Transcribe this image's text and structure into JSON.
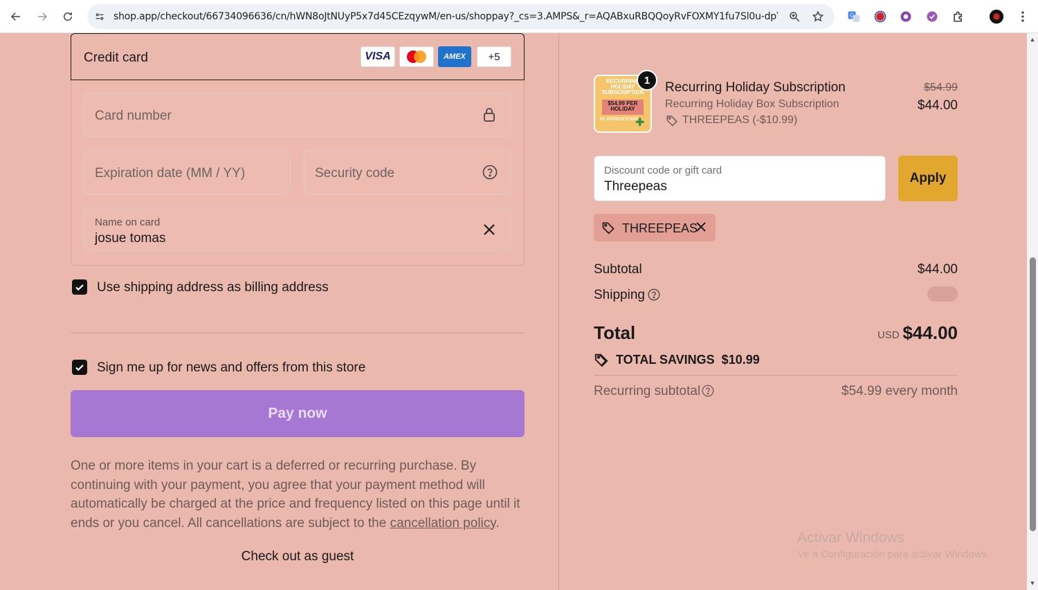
{
  "browser": {
    "url": "shop.app/checkout/66734096636/cn/hWN8oJtNUyP5x7d45CEzqywM/en-us/shoppay?_cs=3.AMPS&_r=AQABxuRBQQoyRvFOXMY1fu7Sl0u-dpYto-..."
  },
  "payment": {
    "credit_card_label": "Credit card",
    "brands": {
      "visa": "VISA",
      "amex": "AMEX",
      "more": "+5"
    },
    "card_number_placeholder": "Card number",
    "expiration_placeholder": "Expiration date (MM / YY)",
    "security_placeholder": "Security code",
    "name_label": "Name on card",
    "name_value": "josue tomas"
  },
  "options": {
    "billing_label": "Use shipping address as billing address",
    "newsletter_label": "Sign me up for news and offers from this store"
  },
  "pay_button": "Pay now",
  "disclaimer": {
    "text": "One or more items in your cart is a deferred or recurring purchase. By continuing with your payment, you agree that your payment method will automatically be charged at the price and frequency listed on this page until it ends or you cancel. All cancellations are subject to the ",
    "link": "cancellation policy",
    "end": "."
  },
  "guest_link": "Check out as guest",
  "summary": {
    "product": {
      "quantity": "1",
      "title": "Recurring Holiday Subscription",
      "subtitle": "Recurring Holiday Box Subscription",
      "discount_code": "THREEPEAS (-$10.99)",
      "price_old": "$54.99",
      "price_new": "$44.00",
      "thumb_text_top": "RECURRING HOLIDAY SUBSCRIPTION",
      "thumb_text_mid": "$54.99 PER HOLIDAY",
      "thumb_text_bottom": "ST. PATRICK'S DAY"
    },
    "discount_field_label": "Discount code or gift card",
    "discount_field_value": "Threepeas",
    "apply_button": "Apply",
    "applied_code": "THREEPEAS",
    "subtotal_label": "Subtotal",
    "subtotal_value": "$44.00",
    "shipping_label": "Shipping",
    "total_label": "Total",
    "total_currency": "USD",
    "total_value": "$44.00",
    "savings_label": "TOTAL SAVINGS  $10.99",
    "recurring_label": "Recurring subtotal",
    "recurring_value": "$54.99 every month"
  },
  "watermark": {
    "line1": "Activar Windows",
    "line2": "Ve a Configuración para activar Windows."
  },
  "colors": {
    "page_bg": "#ebb8ae",
    "pay_button": "#a678d3",
    "apply_button": "#e2a72e",
    "amex_blue": "#1f72cd",
    "visa_blue": "#1a1f71"
  }
}
